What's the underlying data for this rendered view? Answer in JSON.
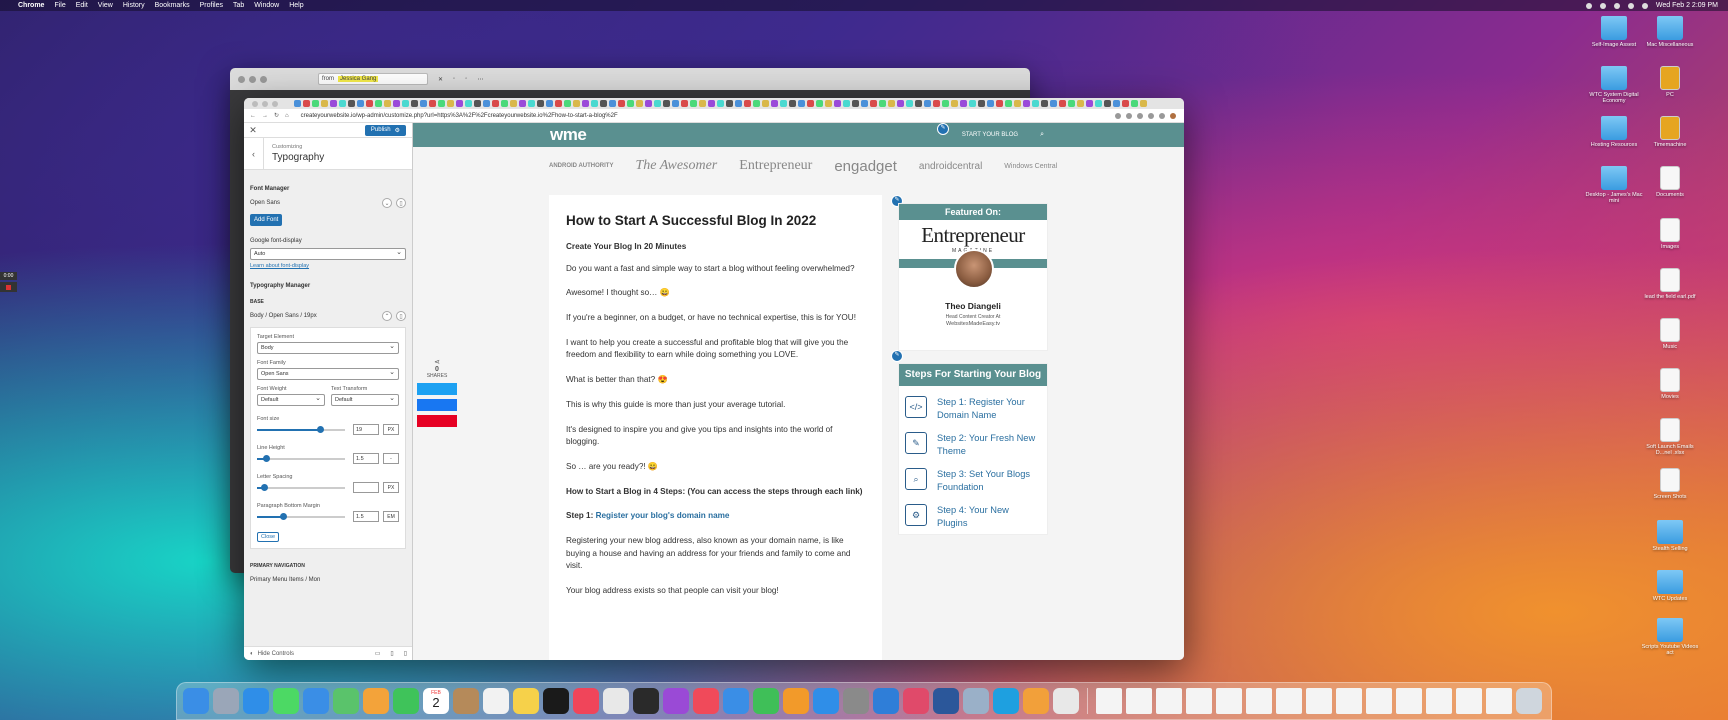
{
  "menubar": {
    "app": "Chrome",
    "items": [
      "File",
      "Edit",
      "View",
      "History",
      "Bookmarks",
      "Profiles",
      "Tab",
      "Window",
      "Help"
    ],
    "clock": "Wed Feb 2  2:09 PM"
  },
  "back_window": {
    "from_label": "from",
    "from_value": "Jessica Gang"
  },
  "browser": {
    "url": "createyourwebsite.io/wp-admin/customize.php?url=https%3A%2F%2Fcreateyourwebsite.io%2Fhow-to-start-a-blog%2F"
  },
  "customizer": {
    "publish": "Publish",
    "customizing": "Customizing",
    "section_title": "Typography",
    "font_manager": "Font Manager",
    "font_name": "Open Sans",
    "add_font": "Add Font",
    "font_display_label": "Google font-display",
    "font_display_value": "Auto",
    "learn_more": "Learn about font-display",
    "typography_manager": "Typography Manager",
    "base_label": "BASE",
    "base_item": "Body / Open Sans / 19px",
    "target_element_label": "Target Element",
    "target_element_value": "Body",
    "font_family_label": "Font Family",
    "font_family_value": "Open Sans",
    "font_weight_label": "Font Weight",
    "font_weight_value": "Default",
    "text_transform_label": "Text Transform",
    "text_transform_value": "Default",
    "font_size_label": "Font size",
    "font_size_value": "19",
    "font_size_unit": "PX",
    "line_height_label": "Line Height",
    "line_height_value": "1.5",
    "line_height_unit": "-",
    "letter_spacing_label": "Letter Spacing",
    "letter_spacing_value": "",
    "letter_spacing_unit": "PX",
    "para_margin_label": "Paragraph Bottom Margin",
    "para_margin_value": "1.5",
    "para_margin_unit": "EM",
    "close": "Close",
    "primary_nav": "PRIMARY NAVIGATION",
    "primary_nav_item": "Primary Menu Items / Mon",
    "hide_controls": "Hide Controls",
    "sliders": {
      "font_size": 0.72,
      "line_height": 0.1,
      "letter_spacing": 0.08,
      "para_margin": 0.3
    }
  },
  "site": {
    "logo": "wme",
    "start_blog": "START YOUR BLOG",
    "brands": [
      "ANDROID AUTHORITY",
      "The Awesomer",
      "Entrepreneur",
      "engadget",
      "androidcentral",
      "Windows Central"
    ],
    "share_count": "0",
    "share_label": "SHARES",
    "article": {
      "title": "How to Start A Successful Blog In 2022",
      "subtitle": "Create Your Blog In 20 Minutes",
      "p1": "Do you want a fast and simple way to start a blog without feeling overwhelmed?",
      "p2": "Awesome! I thought so… 😀",
      "p3": "If you're a beginner, on a budget, or have no technical expertise, this is for YOU!",
      "p4": "I want to help you create a successful and profitable blog that will give you the freedom and flexibility to earn while doing something you LOVE.",
      "p5": "What is better than that? 😍",
      "p6": "This is why this guide is more than just your average tutorial.",
      "p7": "It's designed to inspire you and give you tips and insights into the world of blogging.",
      "p8": "So … are you ready?! 😀",
      "steps_heading": "How to Start a Blog in 4 Steps: (You can access the steps through each link)",
      "step1_prefix": "Step 1:",
      "step1_link": "Register your blog's domain name",
      "p9": "Registering your new blog address, also known as your domain name, is like buying a house and having an address for your friends and family to come and visit.",
      "p10": "Your blog address exists so that people can visit your blog!"
    },
    "featured": {
      "heading": "Featured On:",
      "brand": "Entrepreneur",
      "brand_sub": "MAGAZINE",
      "name": "Theo Diangeli",
      "role": "Head Content Creator At",
      "site": "WebsitesMadeEasy.tv"
    },
    "steps_box": {
      "heading": "Steps For Starting Your Blog",
      "items": [
        {
          "label": "Step 1: Register Your Domain Name",
          "icon": "code-icon"
        },
        {
          "label": "Step 2: Your Fresh New Theme",
          "icon": "pencil-icon"
        },
        {
          "label": "Step 3: Set Your Blogs Foundation",
          "icon": "magnifier-icon"
        },
        {
          "label": "Step 4: Your New Plugins",
          "icon": "gear-icon"
        }
      ]
    }
  },
  "desktop_icons": [
    {
      "label": "Self-Image Assest",
      "type": "folder"
    },
    {
      "label": "Mac Miscellaneous",
      "type": "folder"
    },
    {
      "label": "WTC System Digital Economy",
      "type": "folder"
    },
    {
      "label": "PC",
      "type": "drive"
    },
    {
      "label": "Hosting Resources",
      "type": "folder"
    },
    {
      "label": "Timemachine",
      "type": "drive"
    },
    {
      "label": "Desktop - James's Mac mini",
      "type": "folder"
    },
    {
      "label": "Documents",
      "type": "doc"
    },
    {
      "label": "Images",
      "type": "doc"
    },
    {
      "label": "lead the field earl.pdf",
      "type": "doc"
    },
    {
      "label": "Music",
      "type": "doc"
    },
    {
      "label": "Movies",
      "type": "doc"
    },
    {
      "label": "Soft Launch Emails D...nel .xlsx",
      "type": "doc"
    },
    {
      "label": "Screen Shots",
      "type": "doc"
    },
    {
      "label": "Stealth Selling",
      "type": "folder"
    },
    {
      "label": "WTC Updates",
      "type": "folder"
    },
    {
      "label": "Scripts Youtube Videos act",
      "type": "folder"
    }
  ],
  "recorder": {
    "time": "0:00"
  },
  "dock": {
    "calendar_month": "FEB",
    "calendar_day": "2",
    "apps": [
      {
        "name": "finder-icon",
        "color": "#3a8ee6"
      },
      {
        "name": "launchpad-icon",
        "color": "#9aa6b8"
      },
      {
        "name": "safari-icon",
        "color": "#2f8ee8"
      },
      {
        "name": "messages-icon",
        "color": "#4cd964"
      },
      {
        "name": "mail-icon",
        "color": "#3a8ee6"
      },
      {
        "name": "maps-icon",
        "color": "#5ac36b"
      },
      {
        "name": "photos-icon",
        "color": "#f3a33a"
      },
      {
        "name": "facetime-icon",
        "color": "#3fc35a"
      },
      {
        "name": "calendar-icon",
        "color": "#ffffff"
      },
      {
        "name": "contacts-icon",
        "color": "#b58a5a"
      },
      {
        "name": "reminders-icon",
        "color": "#f2f2f2"
      },
      {
        "name": "notes-icon",
        "color": "#f6d14a"
      },
      {
        "name": "tv-icon",
        "color": "#1a1a1a"
      },
      {
        "name": "music-icon",
        "color": "#f0455a"
      },
      {
        "name": "chrome-icon",
        "color": "#e8e8e8"
      },
      {
        "name": "stocks-icon",
        "color": "#2a2a2a"
      },
      {
        "name": "podcasts-icon",
        "color": "#9a4ad6"
      },
      {
        "name": "news-icon",
        "color": "#f04a5a"
      },
      {
        "name": "keynote-icon",
        "color": "#3a8ee6"
      },
      {
        "name": "numbers-icon",
        "color": "#3fbf58"
      },
      {
        "name": "pages-icon",
        "color": "#f29a2a"
      },
      {
        "name": "appstore-icon",
        "color": "#2f8ee8"
      },
      {
        "name": "settings-icon",
        "color": "#8a8a8a"
      },
      {
        "name": "testflight-icon",
        "color": "#2f7ed8"
      },
      {
        "name": "affinity-icon",
        "color": "#e04a6a"
      },
      {
        "name": "word-icon",
        "color": "#2b579a"
      },
      {
        "name": "preview-icon",
        "color": "#9ab0c8"
      },
      {
        "name": "skype-icon",
        "color": "#1ea0e0"
      },
      {
        "name": "garageband-icon",
        "color": "#f2a03a"
      },
      {
        "name": "slack-icon",
        "color": "#e8e8e8"
      }
    ]
  }
}
